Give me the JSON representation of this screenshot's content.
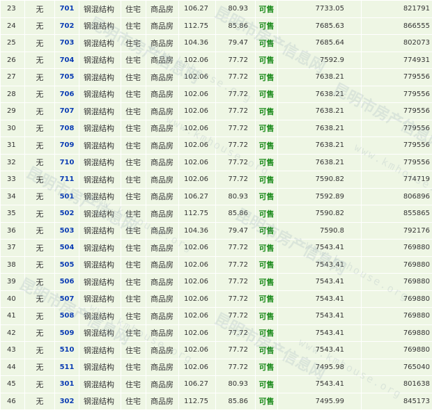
{
  "table": {
    "rows": [
      {
        "idx": "23",
        "wu": "无",
        "room": "701",
        "struct": "钢混结构",
        "use": "住宅",
        "kind": "商品房",
        "area": "106.27",
        "inner": "80.93",
        "status": "可售",
        "price": "7733.05",
        "total": "821791"
      },
      {
        "idx": "24",
        "wu": "无",
        "room": "702",
        "struct": "钢混结构",
        "use": "住宅",
        "kind": "商品房",
        "area": "112.75",
        "inner": "85.86",
        "status": "可售",
        "price": "7685.63",
        "total": "866555"
      },
      {
        "idx": "25",
        "wu": "无",
        "room": "703",
        "struct": "钢混结构",
        "use": "住宅",
        "kind": "商品房",
        "area": "104.36",
        "inner": "79.47",
        "status": "可售",
        "price": "7685.64",
        "total": "802073"
      },
      {
        "idx": "26",
        "wu": "无",
        "room": "704",
        "struct": "钢混结构",
        "use": "住宅",
        "kind": "商品房",
        "area": "102.06",
        "inner": "77.72",
        "status": "可售",
        "price": "7592.9",
        "total": "774931"
      },
      {
        "idx": "27",
        "wu": "无",
        "room": "705",
        "struct": "钢混结构",
        "use": "住宅",
        "kind": "商品房",
        "area": "102.06",
        "inner": "77.72",
        "status": "可售",
        "price": "7638.21",
        "total": "779556"
      },
      {
        "idx": "28",
        "wu": "无",
        "room": "706",
        "struct": "钢混结构",
        "use": "住宅",
        "kind": "商品房",
        "area": "102.06",
        "inner": "77.72",
        "status": "可售",
        "price": "7638.21",
        "total": "779556"
      },
      {
        "idx": "29",
        "wu": "无",
        "room": "707",
        "struct": "钢混结构",
        "use": "住宅",
        "kind": "商品房",
        "area": "102.06",
        "inner": "77.72",
        "status": "可售",
        "price": "7638.21",
        "total": "779556"
      },
      {
        "idx": "30",
        "wu": "无",
        "room": "708",
        "struct": "钢混结构",
        "use": "住宅",
        "kind": "商品房",
        "area": "102.06",
        "inner": "77.72",
        "status": "可售",
        "price": "7638.21",
        "total": "779556"
      },
      {
        "idx": "31",
        "wu": "无",
        "room": "709",
        "struct": "钢混结构",
        "use": "住宅",
        "kind": "商品房",
        "area": "102.06",
        "inner": "77.72",
        "status": "可售",
        "price": "7638.21",
        "total": "779556"
      },
      {
        "idx": "32",
        "wu": "无",
        "room": "710",
        "struct": "钢混结构",
        "use": "住宅",
        "kind": "商品房",
        "area": "102.06",
        "inner": "77.72",
        "status": "可售",
        "price": "7638.21",
        "total": "779556"
      },
      {
        "idx": "33",
        "wu": "无",
        "room": "711",
        "struct": "钢混结构",
        "use": "住宅",
        "kind": "商品房",
        "area": "102.06",
        "inner": "77.72",
        "status": "可售",
        "price": "7590.82",
        "total": "774719"
      },
      {
        "idx": "34",
        "wu": "无",
        "room": "501",
        "struct": "钢混结构",
        "use": "住宅",
        "kind": "商品房",
        "area": "106.27",
        "inner": "80.93",
        "status": "可售",
        "price": "7592.89",
        "total": "806896"
      },
      {
        "idx": "35",
        "wu": "无",
        "room": "502",
        "struct": "钢混结构",
        "use": "住宅",
        "kind": "商品房",
        "area": "112.75",
        "inner": "85.86",
        "status": "可售",
        "price": "7590.82",
        "total": "855865"
      },
      {
        "idx": "36",
        "wu": "无",
        "room": "503",
        "struct": "钢混结构",
        "use": "住宅",
        "kind": "商品房",
        "area": "104.36",
        "inner": "79.47",
        "status": "可售",
        "price": "7590.8",
        "total": "792176"
      },
      {
        "idx": "37",
        "wu": "无",
        "room": "504",
        "struct": "钢混结构",
        "use": "住宅",
        "kind": "商品房",
        "area": "102.06",
        "inner": "77.72",
        "status": "可售",
        "price": "7543.41",
        "total": "769880"
      },
      {
        "idx": "38",
        "wu": "无",
        "room": "505",
        "struct": "钢混结构",
        "use": "住宅",
        "kind": "商品房",
        "area": "102.06",
        "inner": "77.72",
        "status": "可售",
        "price": "7543.41",
        "total": "769880"
      },
      {
        "idx": "39",
        "wu": "无",
        "room": "506",
        "struct": "钢混结构",
        "use": "住宅",
        "kind": "商品房",
        "area": "102.06",
        "inner": "77.72",
        "status": "可售",
        "price": "7543.41",
        "total": "769880"
      },
      {
        "idx": "40",
        "wu": "无",
        "room": "507",
        "struct": "钢混结构",
        "use": "住宅",
        "kind": "商品房",
        "area": "102.06",
        "inner": "77.72",
        "status": "可售",
        "price": "7543.41",
        "total": "769880"
      },
      {
        "idx": "41",
        "wu": "无",
        "room": "508",
        "struct": "钢混结构",
        "use": "住宅",
        "kind": "商品房",
        "area": "102.06",
        "inner": "77.72",
        "status": "可售",
        "price": "7543.41",
        "total": "769880"
      },
      {
        "idx": "42",
        "wu": "无",
        "room": "509",
        "struct": "钢混结构",
        "use": "住宅",
        "kind": "商品房",
        "area": "102.06",
        "inner": "77.72",
        "status": "可售",
        "price": "7543.41",
        "total": "769880"
      },
      {
        "idx": "43",
        "wu": "无",
        "room": "510",
        "struct": "钢混结构",
        "use": "住宅",
        "kind": "商品房",
        "area": "102.06",
        "inner": "77.72",
        "status": "可售",
        "price": "7543.41",
        "total": "769880"
      },
      {
        "idx": "44",
        "wu": "无",
        "room": "511",
        "struct": "钢混结构",
        "use": "住宅",
        "kind": "商品房",
        "area": "102.06",
        "inner": "77.72",
        "status": "可售",
        "price": "7495.98",
        "total": "765040"
      },
      {
        "idx": "45",
        "wu": "无",
        "room": "301",
        "struct": "钢混结构",
        "use": "住宅",
        "kind": "商品房",
        "area": "106.27",
        "inner": "80.93",
        "status": "可售",
        "price": "7543.41",
        "total": "801638"
      },
      {
        "idx": "46",
        "wu": "无",
        "room": "302",
        "struct": "钢混结构",
        "use": "住宅",
        "kind": "商品房",
        "area": "112.75",
        "inner": "85.86",
        "status": "可售",
        "price": "7495.99",
        "total": "845173"
      }
    ]
  },
  "watermark": {
    "text": "昆明市房产信息网",
    "url": "www.kmhouse.org"
  },
  "colors": {
    "row_bg": "#eef6e4",
    "room_link": "#0a3cb4",
    "status_available": "#1a8a1a"
  }
}
